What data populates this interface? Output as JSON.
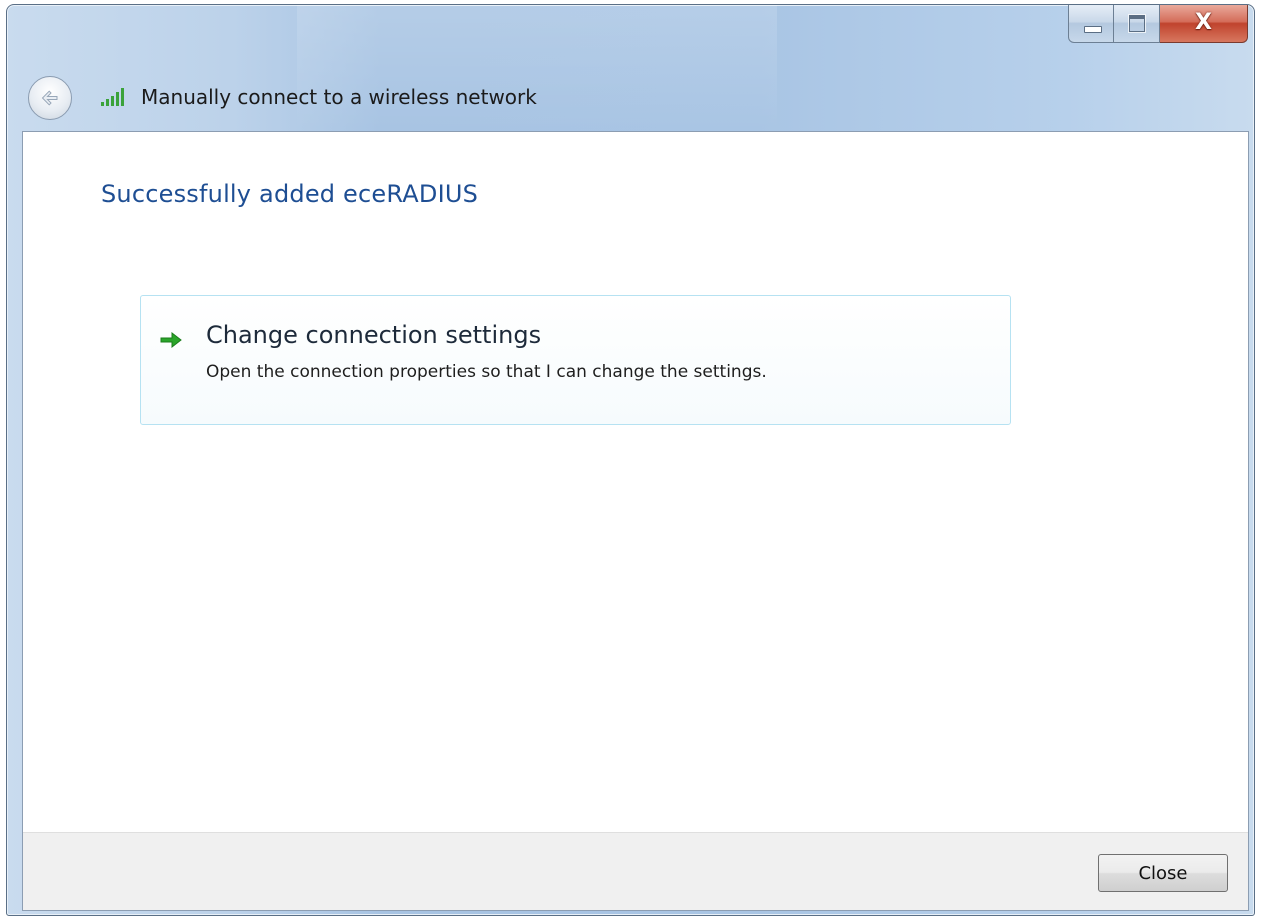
{
  "window": {
    "title": "Manually connect to a wireless network",
    "caption_buttons": {
      "minimize_icon": "minimize-icon",
      "maximize_icon": "maximize-icon",
      "close_icon": "close-icon",
      "close_glyph": "X"
    },
    "back_icon": "back-arrow-icon",
    "title_icon": "wireless-signal-icon"
  },
  "content": {
    "heading": "Successfully added eceRADIUS",
    "command_link": {
      "icon": "green-arrow-icon",
      "label": "Change connection settings",
      "description": "Open the connection properties so that I can change the settings."
    }
  },
  "footer": {
    "close_label": "Close"
  },
  "colors": {
    "heading": "#1e4e93",
    "command_link_border": "#b6e2f2",
    "arrow_green": "#2aa52a",
    "close_caption": "#c0432d"
  }
}
